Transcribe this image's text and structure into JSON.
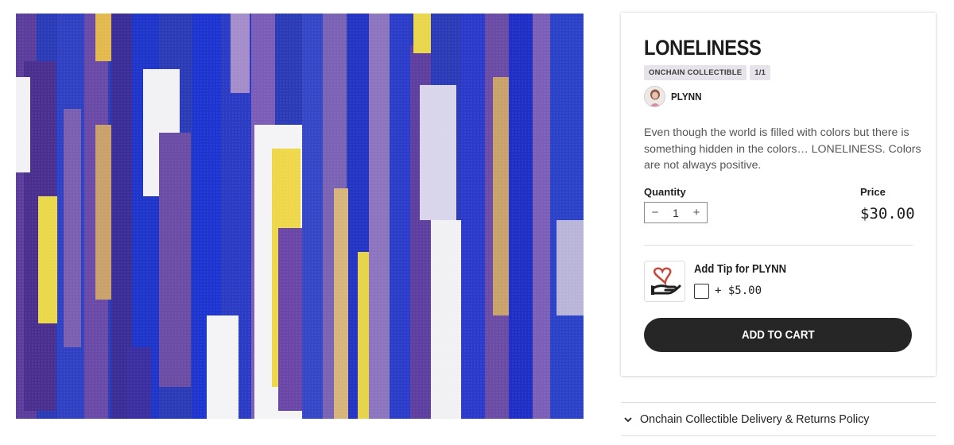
{
  "product": {
    "title": "LONELINESS",
    "badges": [
      "ONCHAIN COLLECTIBLE",
      "1/1"
    ],
    "artist": "PLYNN",
    "description": "Even though the world is filled with colors but there is something hidden in the colors… LONELINESS. Colors are not always positive.",
    "quantity_label": "Quantity",
    "quantity_value": "1",
    "price_label": "Price",
    "price_value": "$30.00"
  },
  "tip": {
    "title": "Add Tip for PLYNN",
    "amount": "+ $5.00"
  },
  "cart": {
    "button_label": "ADD TO CART"
  },
  "policy": {
    "label": "Onchain Collectible Delivery & Returns Policy"
  },
  "stepper": {
    "minus": "−",
    "plus": "+"
  },
  "colors": {
    "button_bg": "#262626",
    "badge_bg": "#e6e4ea",
    "tip_heart": "#c7493a"
  },
  "icons": [
    "minus-icon",
    "plus-icon",
    "hand-heart-icon",
    "chevron-down-icon"
  ]
}
